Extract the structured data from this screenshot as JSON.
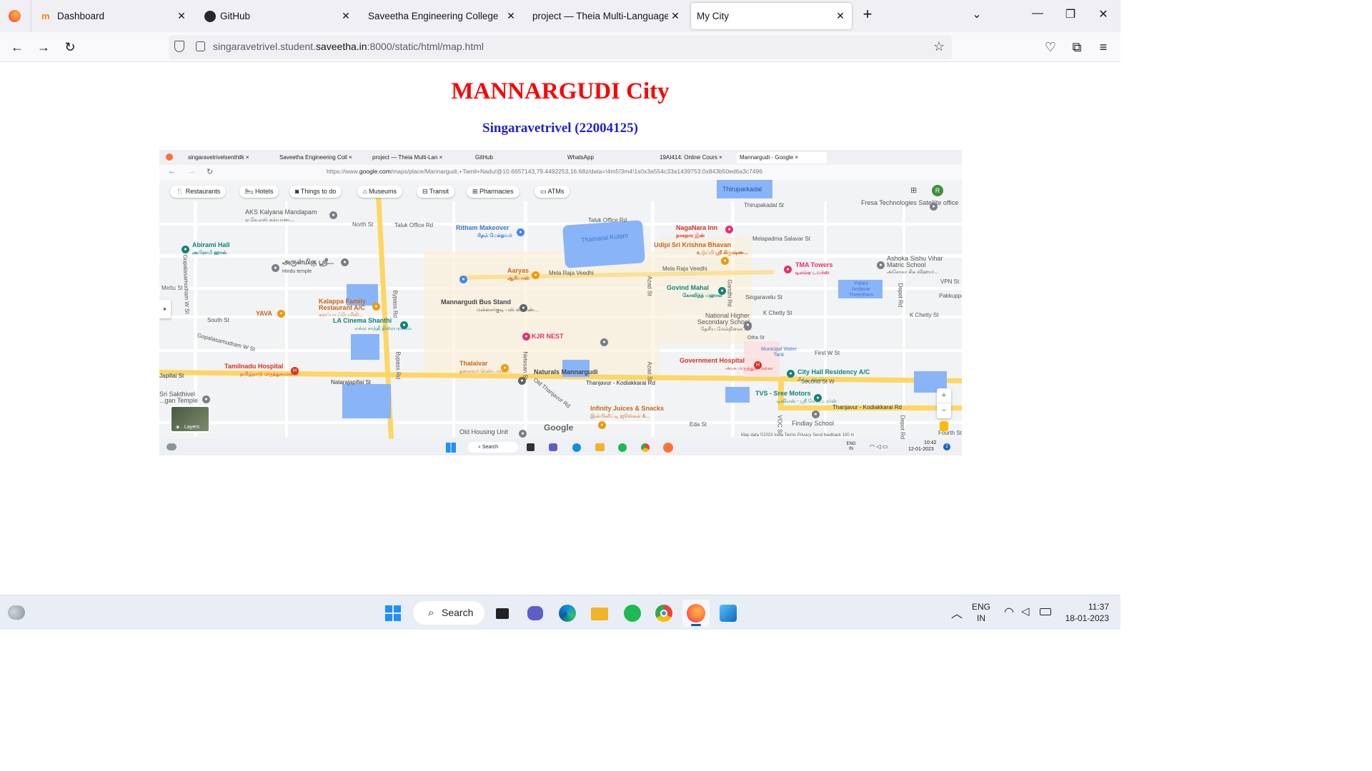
{
  "browser": {
    "tabs": [
      {
        "label": "Dashboard",
        "icon": "moodle-icon"
      },
      {
        "label": "GitHub",
        "icon": "github-icon"
      },
      {
        "label": "Saveetha Engineering College",
        "icon": "none"
      },
      {
        "label": "project — Theia Multi-Language Ex",
        "icon": "none"
      },
      {
        "label": "My City",
        "icon": "none"
      }
    ],
    "url_prefix": "singaravetrivel.student.",
    "url_domain": "saveetha.in",
    "url_suffix": ":8000/static/html/map.html"
  },
  "page": {
    "title": "MANNARGUDI City",
    "subtitle": "Singaravetrivel (22004125)"
  },
  "screenshot": {
    "tabs": [
      "singaravetrivelsenthilk ×",
      "Saveetha Engineering Coll ×",
      "project — Theia Multi-Lan ×",
      "GitHub",
      "WhatsApp",
      "19AI414: Online Cours ×",
      "Mannargudi - Google ×"
    ],
    "url_prefix": "https://www.",
    "url_domain": "google.com",
    "url_suffix": "/maps/place/Mannargudi,+Tamil+Nadu/@10.6657143,79.4492253,16.68z/data=!4m5!3m4!1s0x3a554c33a1439753:0x843b50ed6a3c7496",
    "chips": [
      "Restaurants",
      "Hotels",
      "Things to do",
      "Museums",
      "Transit",
      "Pharmacies",
      "ATMs"
    ],
    "streets": [
      "North St",
      "Taluk Office Rd",
      "Taluk Office Rd",
      "Mela Raja Veedhi",
      "Mela Raja Veedhi",
      "Mettu St",
      "South St",
      "Gopalasamudram W St",
      "Gopalasamudram W St",
      "Natarajapillai St",
      "Japillai St",
      "Thanjavur - Kodiakkarai Rd",
      "Thanjavur - Kodiakkarai Rd",
      "Old Thanjavur Rd",
      "Bypass Rd",
      "Bypass Rd",
      "Thirupakadal St",
      "Melapadma Salavar St",
      "Singaravelu St",
      "K Chetty St",
      "K Chetty St",
      "First W St",
      "Second St W",
      "VPN St",
      "Pakkuppettai",
      "Eda St",
      "Gandhi Rd",
      "Azad St",
      "Azad St",
      "Netesan St",
      "Depot Rd",
      "Depot Rd",
      "VOC St",
      "Fourth St",
      "Thiruparkadal"
    ],
    "places": [
      {
        "name": "AKS Kalyana Mandapam",
        "sub": "ஏ.கே.எஸ் கல்யாண...",
        "cls": "poi-blue"
      },
      {
        "name": "Ritham Makeover",
        "sub": "ரிதம் மேக்ஓவர்",
        "cls": "poi-blue"
      },
      {
        "name": "NagaNara Inn",
        "sub": "நாகநார இன்",
        "cls": "poi-red"
      },
      {
        "name": "Udipi Sri Krishna Bhavan",
        "sub": "உடுப்பி ஸ்ரீ கிருஷ்ண...",
        "cls": "poi-orange"
      },
      {
        "name": "Abirami Hall",
        "sub": "அபிராமி ஹால்",
        "cls": "poi-teal"
      },
      {
        "name": "அருள்மிகு ஸ்ரீ...",
        "sub": "Hindu temple",
        "cls": "poi-grey"
      },
      {
        "name": "Aaryas",
        "sub": "ஆரியாஸ்",
        "cls": "poi-orange"
      },
      {
        "name": "TMA Towers",
        "sub": "டிஎம்ஏ டவர்ஸ்",
        "cls": "poi-pink"
      },
      {
        "name": "Ashoka Sishu Vihar Matric School",
        "sub": "அசோகா சிசு விஹார்...",
        "cls": "poi-grey"
      },
      {
        "name": "Palani Andavar Theertham",
        "sub": "",
        "cls": "poi-blue"
      },
      {
        "name": "Govind Mahal",
        "sub": "கோவிந்த் மஹால்",
        "cls": "poi-teal"
      },
      {
        "name": "Mannargudi Bus Stand",
        "sub": "மன்னார்குடி பஸ் ஸ்டாண்...",
        "cls": "poi-grey"
      },
      {
        "name": "Kalappa Family Restaurant A/C",
        "sub": "கலப்பா ஃபேமிலி...",
        "cls": "poi-orange"
      },
      {
        "name": "YAVA",
        "sub": "",
        "cls": "poi-orange"
      },
      {
        "name": "LA Cinema Shanthi",
        "sub": "எல்ஏ சாந்தி திரையரங்கம்",
        "cls": "poi-teal"
      },
      {
        "name": "National Higher Secondary School",
        "sub": "தேசிய மேல்நிலைப்...",
        "cls": "poi-grey"
      },
      {
        "name": "KJR NEST",
        "sub": "",
        "cls": "poi-pink"
      },
      {
        "name": "Municipal Water Tank",
        "sub": "",
        "cls": "poi-blue"
      },
      {
        "name": "Tamilnadu Hospital",
        "sub": "தமிழ்நாடு மருத்துவமனை",
        "cls": "poi-red"
      },
      {
        "name": "Thalaivar",
        "sub": "தலைவர் ரெஸ்டாரண்ட்",
        "cls": "poi-orange"
      },
      {
        "name": "Naturals Mannargudi",
        "sub": "",
        "cls": "poi-grey"
      },
      {
        "name": "Government Hospital",
        "sub": "அரசு மருத்துவமனை",
        "cls": "poi-red"
      },
      {
        "name": "City Hall Residency A/C",
        "sub": "சிட்டி ஹால்...",
        "cls": "poi-teal"
      },
      {
        "name": "TVS - Sree Motors",
        "sub": "டிவிஎஸ் - ஸ்ரீ மோட்டார்ஸ்",
        "cls": "poi-teal"
      },
      {
        "name": "Fresa Technologies Satellite office",
        "sub": "",
        "cls": "poi-grey"
      },
      {
        "name": "Sri Sakthivel ...gan Temple",
        "sub": "",
        "cls": "poi-grey"
      },
      {
        "name": "Infinity Juices & Snacks",
        "sub": "இன்பினிட்டி ஜூஸ்கள் &...",
        "cls": "poi-orange"
      },
      {
        "name": "Findlay School",
        "sub": "",
        "cls": "poi-grey"
      },
      {
        "name": "Old Housing Unit",
        "sub": "",
        "cls": "poi-grey"
      },
      {
        "name": "Thamarai Kulam",
        "sub": "",
        "cls": "poi-blue"
      },
      {
        "name": "Otha St",
        "sub": "",
        "cls": "poi-grey"
      }
    ],
    "google_logo": "Google",
    "layers_label": "Layers",
    "map_footer": "Map data ©2023   India   Terms   Privacy   Send feedback   100 m",
    "in_taskbar_search": "Search",
    "in_lang": "ENG IN",
    "in_time": "10:42",
    "in_date": "12-01-2023",
    "in_notif": "2"
  },
  "taskbar": {
    "search_label": "Search",
    "lang_line1": "ENG",
    "lang_line2": "IN",
    "time": "11:37",
    "date": "18-01-2023"
  },
  "colors": {
    "title": "#ff0000",
    "subtitle": "#1f1fd0",
    "road_major": "#fdd663",
    "water": "#8ab4f8"
  }
}
